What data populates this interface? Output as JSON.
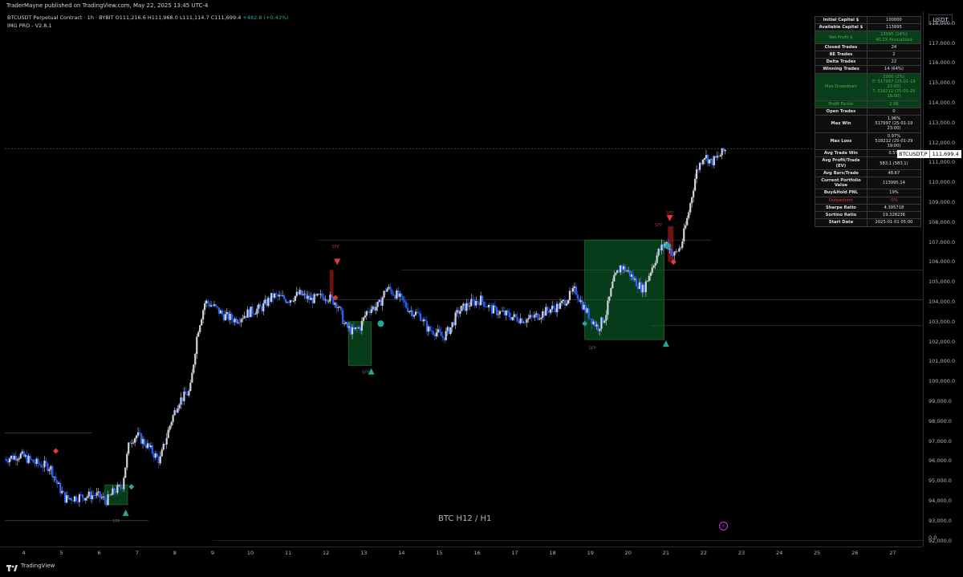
{
  "header": {
    "published": "TraderMayne published on TradingView.com, May 22, 2025 13:45 UTC-4"
  },
  "legend": {
    "symbol_line": "BTCUSDT Perpetual Contract · 1h · BYBIT",
    "ohlc": "O111,216.6  H111,968.0  L111,114.7  C111,699.4",
    "change": "+482.8 (+0.43%)",
    "indicator": "IMG PRO - V2.8.1"
  },
  "currency": "USDT",
  "price_label": {
    "symbol": "BTCUSDT.P",
    "value": "111,699.4"
  },
  "watermark": "BTC H12 / H1",
  "footer": {
    "brand": "TradingView"
  },
  "stats_table": [
    {
      "k": "Initial Capital $",
      "v": "100000",
      "style": ""
    },
    {
      "k": "Available Capital $",
      "v": "113995",
      "style": ""
    },
    {
      "k": "Net Profit $",
      "v": "13995 (14%)",
      "v2": "40.2X Annualised",
      "style": "green"
    },
    {
      "k": "Closed Trades",
      "v": "24",
      "style": ""
    },
    {
      "k": "BE Trades",
      "v": "2",
      "style": ""
    },
    {
      "k": "Delta Trades",
      "v": "22",
      "style": ""
    },
    {
      "k": "Winning Trades",
      "v": "14 (64%)",
      "style": ""
    },
    {
      "k": "Max Drawdown",
      "v": "2000 (2%)",
      "v2": "P: 517997 (25-01-19 23:00)",
      "v3": "T: 518212 (25-01-29 19:00)",
      "style": "green"
    },
    {
      "k": "Profit Factor",
      "v": "2.96",
      "style": "pf"
    },
    {
      "k": "Open Trades",
      "v": "0",
      "style": ""
    },
    {
      "k": "Max Win",
      "v": "1.96%",
      "v2": "517997 (25-01-19 23:00)",
      "style": ""
    },
    {
      "k": "Max Loss",
      "v": "0.97%",
      "v2": "518212 (25-01-29 19:00)",
      "style": ""
    },
    {
      "k": "Avg Trade Win",
      "v": "0.5%",
      "style": ""
    },
    {
      "k": "Avg Profit/Trade (EV)",
      "v": "583.1 (583.1)",
      "style": ""
    },
    {
      "k": "Avg Bars/Trade",
      "v": "48.67",
      "style": ""
    },
    {
      "k": "Current Portfolio Value",
      "v": "113995.14",
      "style": ""
    },
    {
      "k": "Buy&Hold PNL",
      "v": "19%",
      "style": ""
    },
    {
      "k": "Outperform",
      "v": "-5%",
      "style": "red"
    },
    {
      "k": "Sharpe Ratio",
      "v": "4.395718",
      "style": ""
    },
    {
      "k": "Sortino Ratio",
      "v": "19.328236",
      "style": ""
    },
    {
      "k": "Start Date",
      "v": "2025-01-01 05:00",
      "style": ""
    }
  ],
  "chart_data": {
    "type": "line",
    "subtype": "candlestick",
    "x_ticks": [
      "4",
      "5",
      "6",
      "7",
      "8",
      "9",
      "10",
      "11",
      "12",
      "13",
      "14",
      "15",
      "16",
      "17",
      "18",
      "19",
      "20",
      "21",
      "22",
      "23",
      "24",
      "25",
      "26",
      "27"
    ],
    "y_ticks": [
      "118,000.0",
      "117,000.0",
      "116,000.0",
      "115,000.0",
      "114,000.0",
      "113,000.0",
      "112,000.0",
      "111,000.0",
      "110,000.0",
      "109,000.0",
      "108,000.0",
      "107,000.0",
      "106,000.0",
      "105,000.0",
      "104,000.0",
      "103,000.0",
      "102,000.0",
      "101,000.0",
      "100,000.0",
      "99,000.0",
      "98,000.0",
      "97,000.0",
      "96,000.0",
      "95,000.0",
      "94,000.0",
      "93,000.0",
      "92,000.0",
      "0.0"
    ],
    "ylim": [
      91700,
      118600
    ],
    "xlim": [
      3.5,
      27.8
    ],
    "price_path": [
      [
        3.5,
        96100
      ],
      [
        3.9,
        96300
      ],
      [
        4.3,
        95900
      ],
      [
        4.7,
        95700
      ],
      [
        4.9,
        94800
      ],
      [
        5.1,
        94100
      ],
      [
        5.5,
        94200
      ],
      [
        5.9,
        94300
      ],
      [
        6.2,
        94000
      ],
      [
        6.4,
        94500
      ],
      [
        6.6,
        94700
      ],
      [
        6.8,
        97000
      ],
      [
        7.0,
        97300
      ],
      [
        7.3,
        96700
      ],
      [
        7.6,
        96000
      ],
      [
        7.9,
        98000
      ],
      [
        8.1,
        99000
      ],
      [
        8.4,
        99500
      ],
      [
        8.6,
        102500
      ],
      [
        8.8,
        104000
      ],
      [
        9.0,
        103800
      ],
      [
        9.3,
        103300
      ],
      [
        9.6,
        103100
      ],
      [
        10.0,
        103500
      ],
      [
        10.3,
        103700
      ],
      [
        10.6,
        104300
      ],
      [
        11.0,
        104100
      ],
      [
        11.3,
        104400
      ],
      [
        11.6,
        104100
      ],
      [
        12.0,
        104300
      ],
      [
        12.3,
        103900
      ],
      [
        12.5,
        102800
      ],
      [
        12.7,
        102500
      ],
      [
        12.9,
        102700
      ],
      [
        13.1,
        103600
      ],
      [
        13.4,
        103800
      ],
      [
        13.6,
        104700
      ],
      [
        13.9,
        104300
      ],
      [
        14.2,
        103600
      ],
      [
        14.5,
        103300
      ],
      [
        14.7,
        102600
      ],
      [
        14.9,
        102500
      ],
      [
        15.1,
        102200
      ],
      [
        15.3,
        102700
      ],
      [
        15.5,
        103500
      ],
      [
        15.8,
        103900
      ],
      [
        16.1,
        104100
      ],
      [
        16.4,
        103600
      ],
      [
        16.7,
        103400
      ],
      [
        17.0,
        103200
      ],
      [
        17.3,
        103100
      ],
      [
        17.6,
        103300
      ],
      [
        17.9,
        103600
      ],
      [
        18.2,
        103800
      ],
      [
        18.4,
        104200
      ],
      [
        18.6,
        104600
      ],
      [
        18.8,
        103800
      ],
      [
        19.0,
        103200
      ],
      [
        19.2,
        102700
      ],
      [
        19.4,
        103300
      ],
      [
        19.6,
        105000
      ],
      [
        19.8,
        105800
      ],
      [
        20.0,
        105500
      ],
      [
        20.2,
        105000
      ],
      [
        20.4,
        104600
      ],
      [
        20.6,
        105600
      ],
      [
        20.8,
        106500
      ],
      [
        21.0,
        107000
      ],
      [
        21.2,
        106300
      ],
      [
        21.4,
        106800
      ],
      [
        21.6,
        108500
      ],
      [
        21.8,
        110500
      ],
      [
        22.0,
        111400
      ],
      [
        22.2,
        111000
      ],
      [
        22.4,
        111300
      ],
      [
        22.6,
        111700
      ]
    ]
  },
  "annotations": {
    "sfp_labels": [
      "SFP",
      "SFP",
      "SFP",
      "SFP",
      "SFP",
      "SFP"
    ]
  },
  "colors": {
    "up": "#d1d4dc",
    "down": "#2962ff",
    "green_box": "#0d5c2e",
    "green_marker": "#26a69a",
    "red_marker": "#e53935",
    "sfp_red": "#c62828",
    "bg": "#000000"
  }
}
